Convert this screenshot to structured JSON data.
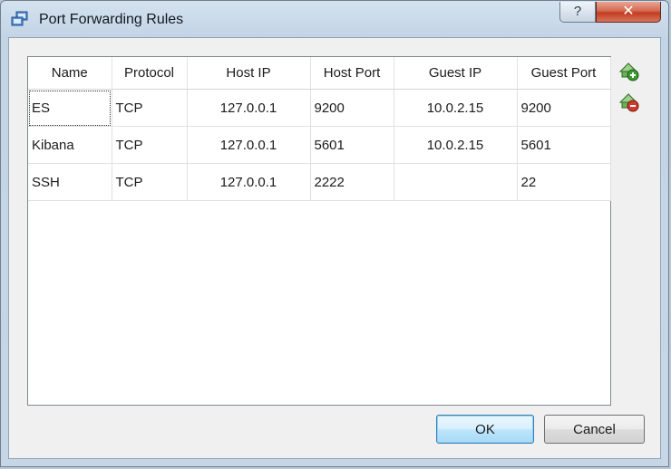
{
  "window": {
    "title": "Port Forwarding Rules",
    "help_label": "?",
    "close_label": "✕"
  },
  "table": {
    "columns": [
      "Name",
      "Protocol",
      "Host IP",
      "Host Port",
      "Guest IP",
      "Guest Port"
    ],
    "rows": [
      {
        "name": "ES",
        "protocol": "TCP",
        "host_ip": "127.0.0.1",
        "host_port": "9200",
        "guest_ip": "10.0.2.15",
        "guest_port": "9200"
      },
      {
        "name": "Kibana",
        "protocol": "TCP",
        "host_ip": "127.0.0.1",
        "host_port": "5601",
        "guest_ip": "10.0.2.15",
        "guest_port": "5601"
      },
      {
        "name": "SSH",
        "protocol": "TCP",
        "host_ip": "127.0.0.1",
        "host_port": "2222",
        "guest_ip": "",
        "guest_port": "22"
      }
    ]
  },
  "side_buttons": {
    "add_icon": "add-rule-icon",
    "remove_icon": "remove-rule-icon"
  },
  "buttons": {
    "ok_label": "OK",
    "cancel_label": "Cancel"
  },
  "colors": {
    "add_icon": "#3b9a2f",
    "remove_icon": "#d03a2a",
    "close_button": "#c23b21"
  }
}
